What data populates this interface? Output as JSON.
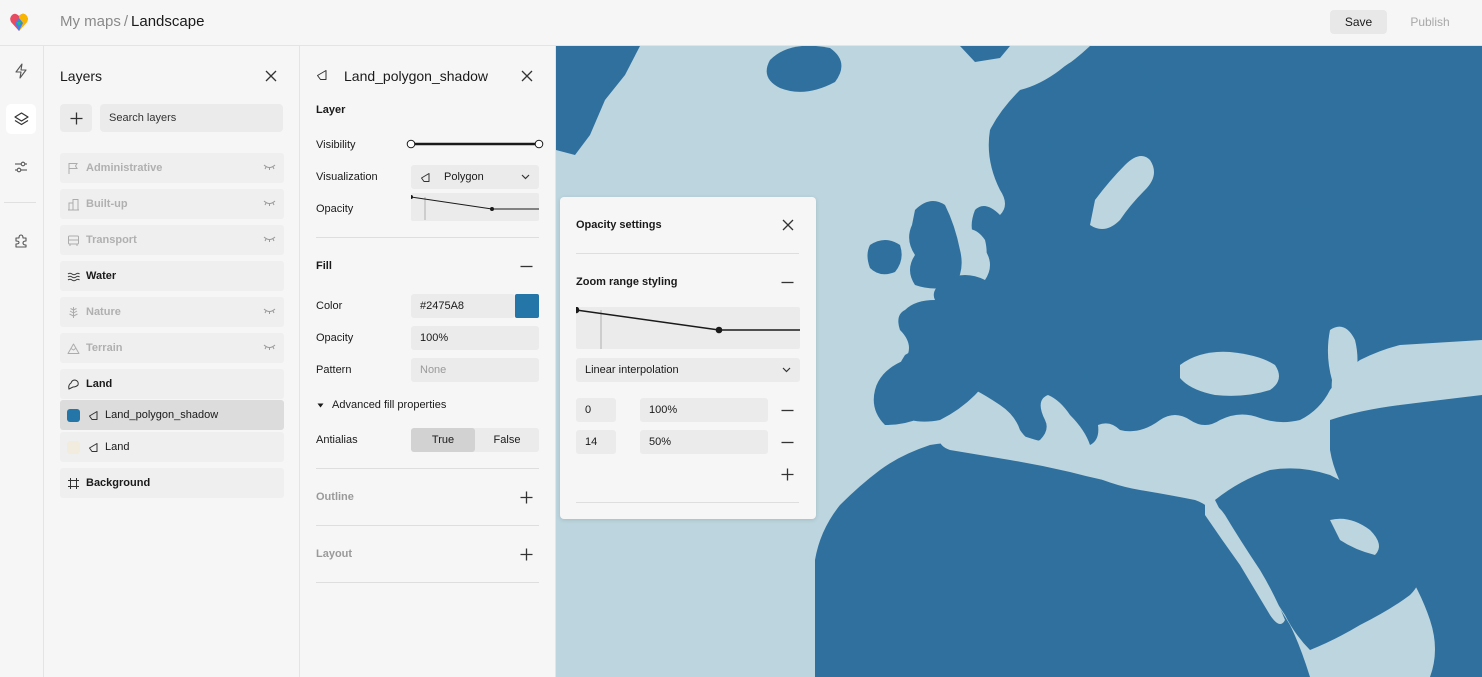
{
  "topbar": {
    "breadcrumb_parent": "My maps",
    "breadcrumb_sep": "/",
    "breadcrumb_current": "Landscape",
    "save_label": "Save",
    "publish_label": "Publish"
  },
  "rail": {
    "items": [
      "bolt-icon",
      "layers-icon",
      "sliders-icon",
      "puzzle-icon"
    ],
    "active": "layers-icon"
  },
  "layers_panel": {
    "title": "Layers",
    "search_placeholder": "Search layers",
    "groups": [
      {
        "label": "Administrative",
        "icon": "flag-icon",
        "hidden": true
      },
      {
        "label": "Built-up",
        "icon": "buildings-icon",
        "hidden": true
      },
      {
        "label": "Transport",
        "icon": "bus-icon",
        "hidden": true
      },
      {
        "label": "Water",
        "icon": "waves-icon",
        "hidden": false
      },
      {
        "label": "Nature",
        "icon": "tree-icon",
        "hidden": true
      },
      {
        "label": "Terrain",
        "icon": "mountain-icon",
        "hidden": true
      },
      {
        "label": "Land",
        "icon": "land-icon",
        "hidden": false
      }
    ],
    "children": [
      {
        "label": "Land_polygon_shadow",
        "swatch": "#2475A8",
        "selected": true
      },
      {
        "label": "Land",
        "swatch": "#F1ECDD",
        "selected": false
      }
    ],
    "background_label": "Background"
  },
  "props_panel": {
    "title": "Land_polygon_shadow",
    "layer_section": "Layer",
    "visibility_label": "Visibility",
    "visualization_label": "Visualization",
    "visualization_value": "Polygon",
    "opacity_label": "Opacity",
    "fill_section": "Fill",
    "color_label": "Color",
    "color_value": "#2475A8",
    "fill_opacity_label": "Opacity",
    "fill_opacity_value": "100%",
    "pattern_label": "Pattern",
    "pattern_value": "None",
    "advanced_label": "Advanced fill properties",
    "antialias_label": "Antialias",
    "antialias_true": "True",
    "antialias_false": "False",
    "outline_section": "Outline",
    "layout_section": "Layout"
  },
  "opacity_popover": {
    "title": "Opacity settings",
    "subtitle": "Zoom range styling",
    "interpolation": "Linear interpolation",
    "stops": [
      {
        "zoom": "0",
        "value": "100%"
      },
      {
        "zoom": "14",
        "value": "50%"
      }
    ]
  },
  "colors": {
    "accent": "#2475A8",
    "land_light": "#F1ECDD",
    "water": "#BCD5DE",
    "map_land": "#2F709E"
  }
}
